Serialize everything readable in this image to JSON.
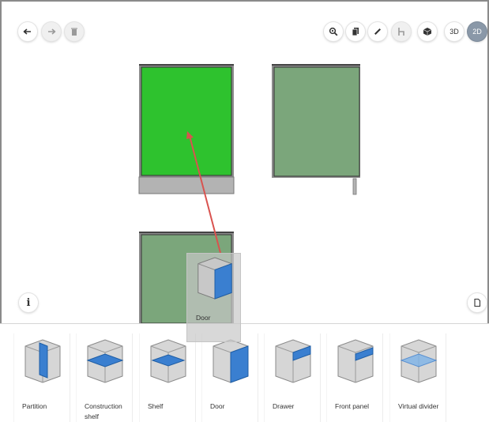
{
  "toolbar": {
    "view_3d_label": "3D",
    "view_2d_label": "2D",
    "active_view": "2D",
    "icons_left": [
      "undo-icon",
      "redo-icon",
      "delete-icon"
    ],
    "icons_right": [
      "zoom-icon",
      "copy-icon",
      "measure-icon",
      "chair-icon",
      "cube-icon"
    ]
  },
  "canvas": {
    "colors": {
      "selected_front": "#2ec22e",
      "default_front": "#7ba67b",
      "plinth": "#b3b3b3",
      "arrow": "#d9534f"
    }
  },
  "drag_preview": {
    "label": "Door"
  },
  "components": [
    {
      "label": "Partition",
      "icon": "partition-icon"
    },
    {
      "label": "Construction shelf",
      "icon": "construction-shelf-icon"
    },
    {
      "label": "Shelf",
      "icon": "shelf-icon"
    },
    {
      "label": "Door",
      "icon": "door-icon"
    },
    {
      "label": "Drawer",
      "icon": "drawer-icon"
    },
    {
      "label": "Front panel",
      "icon": "front-panel-icon"
    },
    {
      "label": "Virtual divider",
      "icon": "virtual-divider-icon"
    }
  ],
  "colors": {
    "accent_blue": "#3a7fd0",
    "active_view_bg": "#8a98a8"
  }
}
